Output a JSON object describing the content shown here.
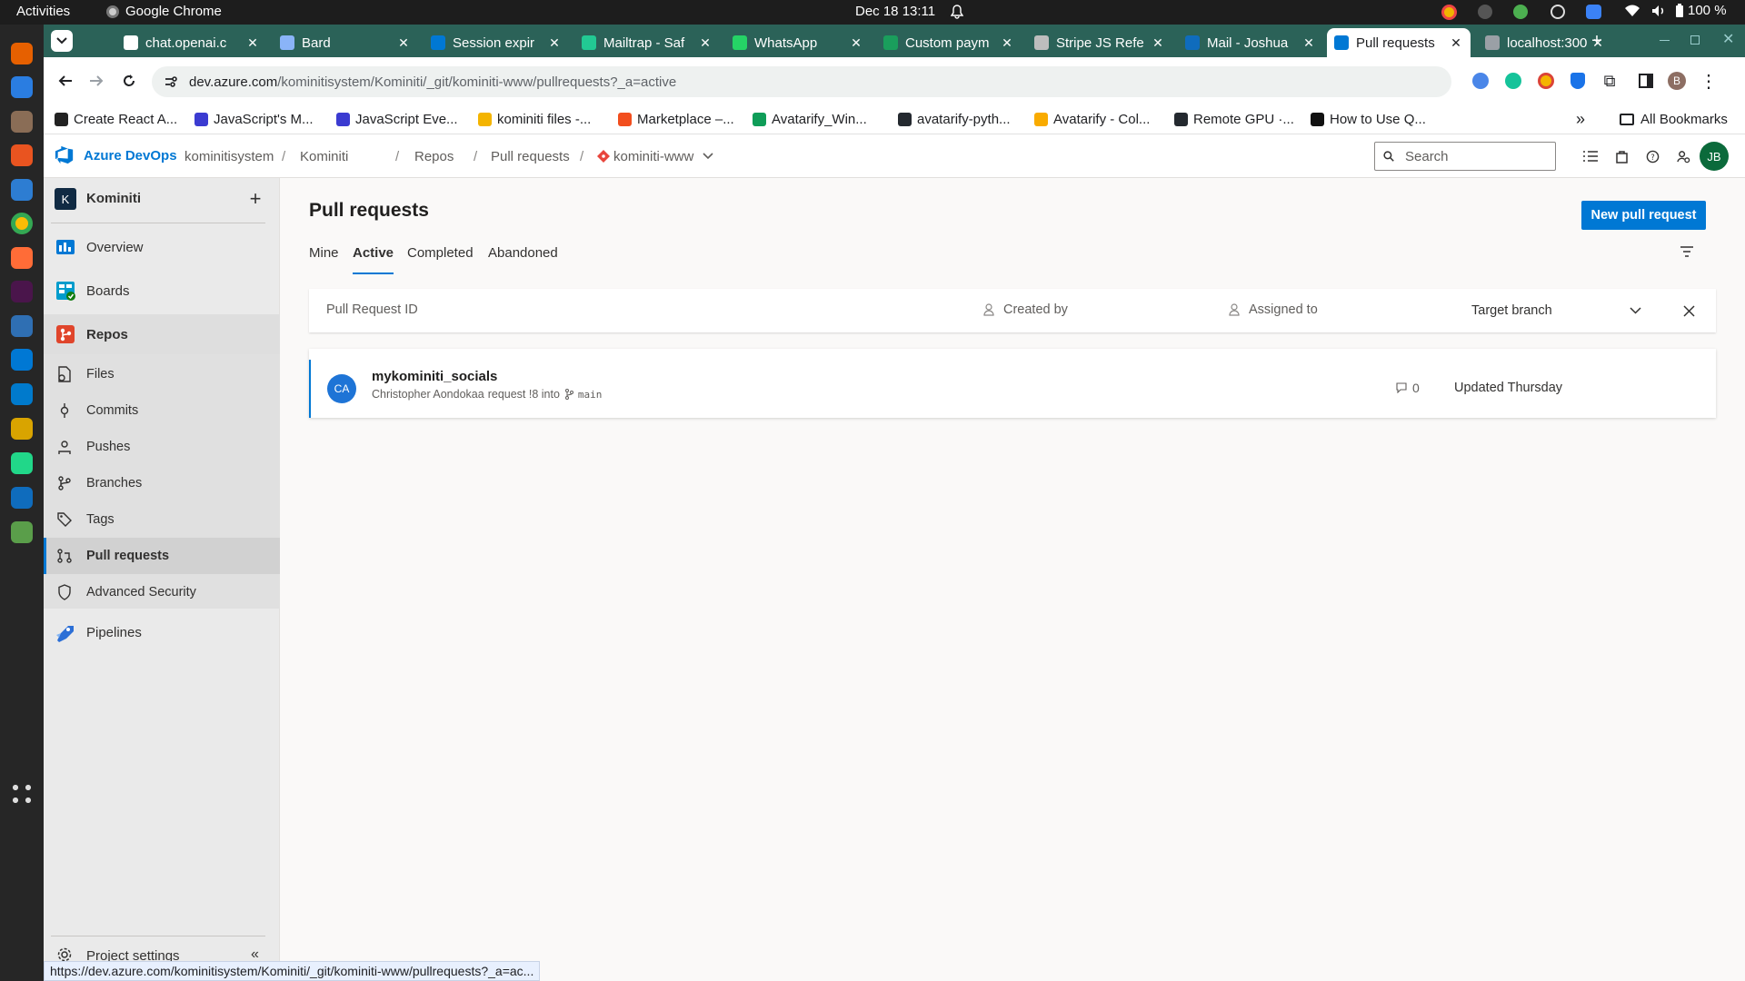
{
  "os": {
    "activities": "Activities",
    "app": "Google Chrome",
    "datetime": "Dec 18  13:11",
    "battery": "100 %"
  },
  "dock": {
    "items": [
      "firefox-icon",
      "thunderbird-icon",
      "files-icon",
      "app-center-icon",
      "help-icon",
      "chrome-icon",
      "postman-icon",
      "slack-icon",
      "monitor-icon",
      "azure-devops-icon",
      "vscode-icon",
      "editor-icon",
      "pycharm-icon",
      "azure-data-studio-icon",
      "trash-icon",
      "apps-grid-icon"
    ]
  },
  "chrome": {
    "tabs": [
      {
        "label": "chat.openai.c",
        "color": "#ffffff",
        "icon": "openai-icon"
      },
      {
        "label": "Bard",
        "color": "#8ab4f8",
        "icon": "bard-icon"
      },
      {
        "label": "Session expir",
        "color": "#0078d4",
        "icon": "azure-icon"
      },
      {
        "label": "Mailtrap - Saf",
        "color": "#22c993",
        "icon": "mailtrap-icon"
      },
      {
        "label": "WhatsApp",
        "color": "#25d366",
        "icon": "whatsapp-icon"
      },
      {
        "label": "Custom paym",
        "color": "#1a9e5c",
        "icon": "s-icon"
      },
      {
        "label": "Stripe JS Refe",
        "color": "#bdbdbd",
        "icon": "stripe-icon"
      },
      {
        "label": "Mail - Joshua",
        "color": "#0f6cbd",
        "icon": "outlook-icon"
      },
      {
        "label": "Pull requests",
        "color": "#0078d4",
        "icon": "azure-devops-icon",
        "active": true
      },
      {
        "label": "localhost:300",
        "color": "#9aa0a6",
        "icon": "localhost-icon"
      }
    ],
    "url_host": "dev.azure.com",
    "url_path": "/kominitisystem/Kominiti/_git/kominiti-www/pullrequests?_a=active",
    "profile_initial": "B",
    "bookmarks": [
      {
        "label": "Create React A...",
        "color": "#222222"
      },
      {
        "label": "JavaScript's M...",
        "color": "#3b3bd1"
      },
      {
        "label": "JavaScript Eve...",
        "color": "#3b3bd1"
      },
      {
        "label": "kominiti files -...",
        "color": "#f4b400"
      },
      {
        "label": "Marketplace –...",
        "color": "#f24e1e"
      },
      {
        "label": "Avatarify_Win...",
        "color": "#0f9d58"
      },
      {
        "label": "avatarify-pyth...",
        "color": "#24292f"
      },
      {
        "label": "Avatarify - Col...",
        "color": "#f9ab00"
      },
      {
        "label": "Remote GPU ·...",
        "color": "#24292f"
      },
      {
        "label": "How to Use Q...",
        "color": "#111111"
      }
    ],
    "all_bookmarks": "All Bookmarks"
  },
  "azure": {
    "brand": "Azure DevOps",
    "breadcrumb": [
      "kominitisystem",
      "Kominiti",
      "Repos",
      "Pull requests"
    ],
    "repo": "kominiti-www",
    "search_placeholder": "Search",
    "user_initials": "JB"
  },
  "sidebar": {
    "project_initial": "K",
    "project": "Kominiti",
    "items": [
      {
        "label": "Overview",
        "icon": "overview-icon"
      },
      {
        "label": "Boards",
        "icon": "boards-icon"
      },
      {
        "label": "Repos",
        "icon": "repos-icon"
      }
    ],
    "repo_items": [
      {
        "label": "Files",
        "icon": "files-icon"
      },
      {
        "label": "Commits",
        "icon": "commits-icon"
      },
      {
        "label": "Pushes",
        "icon": "pushes-icon"
      },
      {
        "label": "Branches",
        "icon": "branches-icon"
      },
      {
        "label": "Tags",
        "icon": "tags-icon"
      },
      {
        "label": "Pull requests",
        "icon": "pull-request-icon"
      },
      {
        "label": "Advanced Security",
        "icon": "shield-icon"
      }
    ],
    "pipelines": "Pipelines",
    "project_settings": "Project settings"
  },
  "main": {
    "title": "Pull requests",
    "new_pr": "New pull request",
    "tabs": [
      "Mine",
      "Active",
      "Completed",
      "Abandoned"
    ],
    "active_tab": "Active",
    "filters": {
      "pr_id_placeholder": "Pull Request ID",
      "created_by": "Created by",
      "assigned_to": "Assigned to",
      "target_branch": "Target branch"
    },
    "pull_requests": [
      {
        "initials": "CA",
        "title": "mykominiti_socials",
        "author": "Christopher Aondokaa",
        "request": "request !8 into",
        "branch": "main",
        "comments": "0",
        "updated": "Updated Thursday"
      }
    ]
  },
  "status_url": "https://dev.azure.com/kominitisystem/Kominiti/_git/kominiti-www/pullrequests?_a=ac..."
}
